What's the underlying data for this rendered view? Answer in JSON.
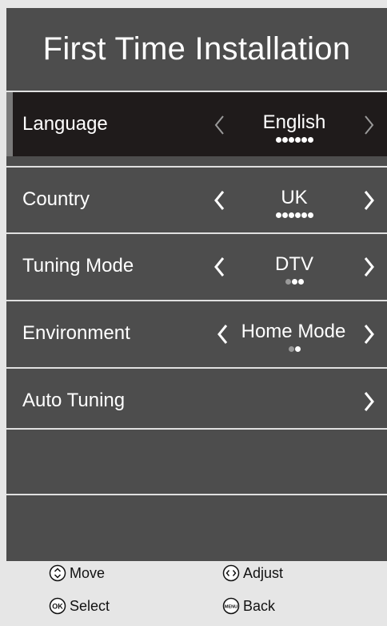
{
  "title": "First Time Installation",
  "rows": [
    {
      "label": "Language",
      "value": "English",
      "dots_total": 6,
      "dots_active": 6,
      "has_left": true,
      "has_right": true
    },
    {
      "label": "Country",
      "value": "UK",
      "dots_total": 6,
      "dots_active": 6,
      "has_left": true,
      "has_right": true
    },
    {
      "label": "Tuning Mode",
      "value": "DTV",
      "dots_total": 3,
      "dots_active": 2,
      "has_left": true,
      "has_right": true
    },
    {
      "label": "Environment",
      "value": "Home Mode",
      "dots_total": 2,
      "dots_active": 1,
      "has_left": true,
      "has_right": true
    },
    {
      "label": "Auto Tuning",
      "value": "",
      "dots_total": 0,
      "dots_active": 0,
      "has_left": false,
      "has_right": true
    }
  ],
  "selected_row": "Language",
  "footer": {
    "move_label": "Move",
    "adjust_label": "Adjust",
    "select_label": "Select",
    "back_label": "Back",
    "ok_icon_text": "OK",
    "menu_icon_text": "MENU"
  },
  "colors": {
    "panel": "#4d4d4d",
    "selected": "#1f1b1b",
    "divider": "#e0e0e0",
    "footer": "#e6e6e6"
  }
}
